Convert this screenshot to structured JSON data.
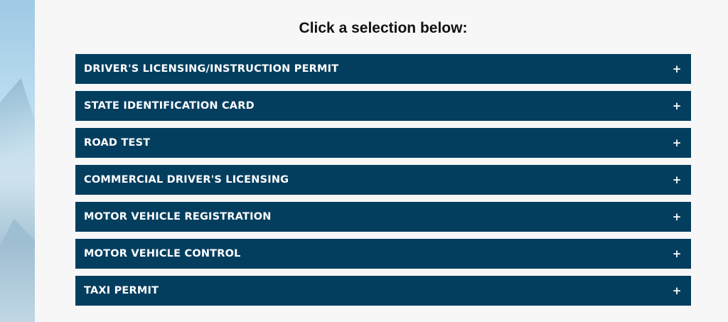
{
  "heading": "Click a selection below:",
  "accordion": {
    "expand_icon": "+",
    "items": [
      {
        "label": "DRIVER'S LICENSING/INSTRUCTION PERMIT"
      },
      {
        "label": "STATE IDENTIFICATION CARD"
      },
      {
        "label": "ROAD TEST"
      },
      {
        "label": "COMMERCIAL DRIVER'S LICENSING"
      },
      {
        "label": "MOTOR VEHICLE REGISTRATION"
      },
      {
        "label": "MOTOR VEHICLE CONTROL"
      },
      {
        "label": "TAXI PERMIT"
      }
    ]
  },
  "colors": {
    "accordion_bg": "#043e5f",
    "accordion_text": "#ffffff",
    "page_bg": "#f7f7f7"
  }
}
